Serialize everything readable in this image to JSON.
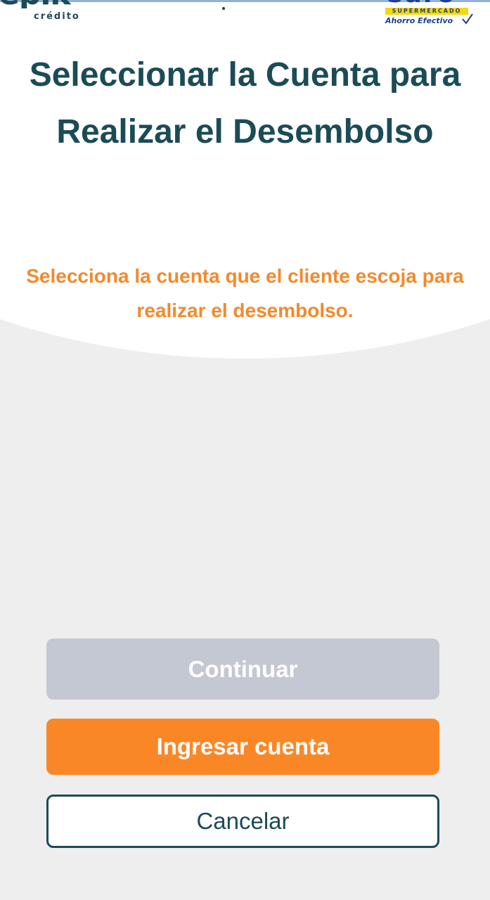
{
  "header": {
    "left_logo": {
      "brand": "epik",
      "subtitle": "crédito"
    },
    "right_logo": {
      "brand": "euro",
      "tagline": "SUPERMERCADO",
      "slogan": "Ahorro Efectivo"
    }
  },
  "main": {
    "title": "Seleccionar la Cuenta para Realizar el Desembolso",
    "subtitle": "Selecciona la cuenta que el cliente escoja para realizar el desembolso."
  },
  "actions": {
    "continue_label": "Continuar",
    "continue_enabled": false,
    "add_account_label": "Ingresar cuenta",
    "cancel_label": "Cancelar"
  },
  "colors": {
    "primary_dark": "#1b4b56",
    "accent_orange": "#fa8726",
    "subtitle_orange": "#f28a2c",
    "disabled_button": "#c3c8d2",
    "background": "#eeeeee",
    "brand_blue": "#1d3f8f",
    "brand_yellow": "#f5d90a"
  }
}
